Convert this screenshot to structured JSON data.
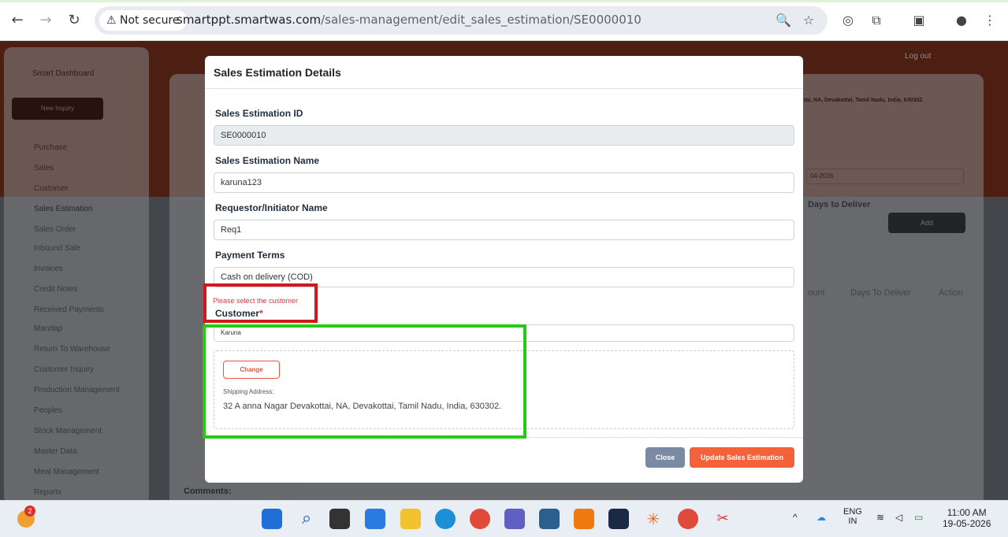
{
  "browser": {
    "security_label": "Not secure",
    "url_host": "smartppt.smartwas.com",
    "url_path": "/sales-management/edit_sales_estimation/SE0000010"
  },
  "app": {
    "brand": "Smart Dashboard",
    "new_inquiry": "New Inquiry",
    "sidebar": [
      "Purchase",
      "Sales",
      "Customer",
      "Sales Estimation",
      "Sales Order",
      "Inbound Sale",
      "Invoices",
      "Credit Notes",
      "Received Payments",
      "Mandap",
      "Return To Warehouse",
      "Customer Inquiry",
      "Production Management",
      "Peoples",
      "Stock Management",
      "Master Data",
      "Meal Management",
      "Reports"
    ],
    "logout": "Log out",
    "bg_address": "tai, NA, Devakottai, Tamil Nadu, India, 630302.",
    "bg_date": "04-2026",
    "bg_days_to_deliver": "Days to Deliver",
    "bg_add": "Add",
    "bg_table_headers": [
      "ount",
      "Days To Deliver",
      "Action"
    ],
    "bg_comments": "Comments:"
  },
  "modal": {
    "title": "Sales Estimation Details",
    "fields": {
      "id_label": "Sales Estimation ID",
      "id_value": "SE0000010",
      "name_label": "Sales Estimation Name",
      "name_value": "karuna123",
      "requestor_label": "Requestor/Initiator Name",
      "requestor_value": "Req1",
      "payment_label": "Payment Terms",
      "payment_value": "Cash on delivery (COD)",
      "customer_error": "Please select the customer",
      "customer_label": "Customer",
      "customer_required": "*",
      "customer_value": "Karuna"
    },
    "address": {
      "change_label": "Change",
      "shipping_label": "Shipping Address:",
      "shipping_value": "32 A anna Nagar Devakottai, NA, Devakottai, Tamil Nadu, India, 630302."
    },
    "close_label": "Close",
    "update_label": "Update Sales Estimation"
  },
  "taskbar": {
    "notification_count": "2",
    "lang": "ENG",
    "region": "IN",
    "time": "11:00 AM",
    "date": "19-05-2026"
  },
  "colors": {
    "accent": "#f4623a",
    "error": "#dc3545",
    "highlight_red": "#d1191b",
    "highlight_green": "#22cc12",
    "close_btn": "#7b8aa3"
  }
}
